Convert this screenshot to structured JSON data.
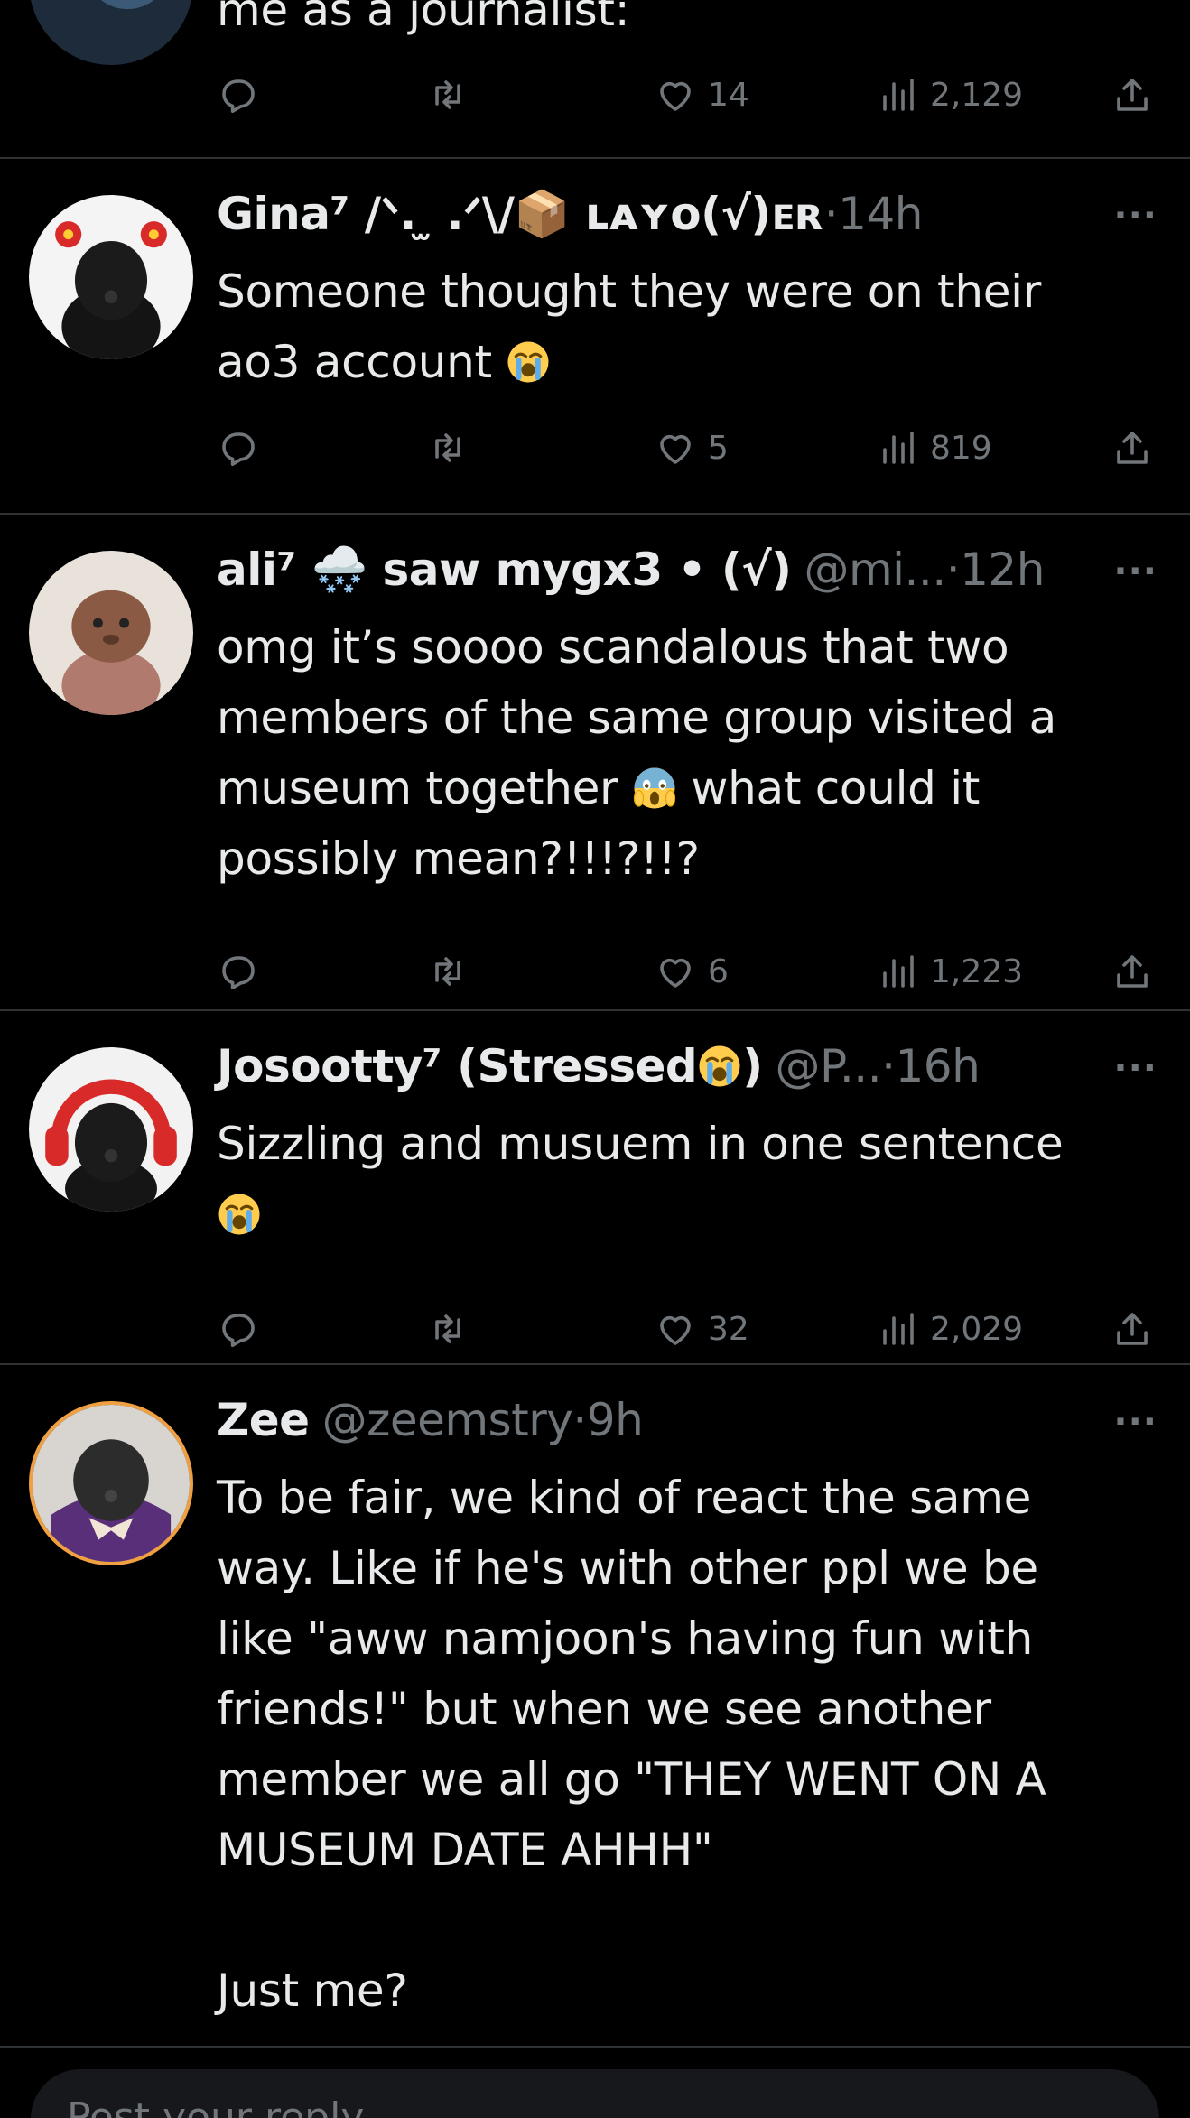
{
  "tweets": [
    {
      "name": "",
      "handle": "",
      "time": "",
      "text": "me as a journalist:",
      "stats": {
        "replies": "",
        "retweets": "",
        "likes": "14",
        "views": "2,129"
      }
    },
    {
      "name": "Gina⁷ /ᐠ. ̫ .ᐟ\\/📦 ʟᴀʏᴏ(√)ᴇʀ",
      "handle": "",
      "time": "14h",
      "text": "Someone thought they were on their\nao3 account ",
      "stats": {
        "replies": "",
        "retweets": "",
        "likes": "5",
        "views": "819"
      }
    },
    {
      "name": "ali⁷ 🌨️ saw mygx3 • (√)",
      "handle": "@mi...",
      "time": "12h",
      "text_a": "omg it’s soooo scandalous that two\nmembers of the same group visited a\nmuseum together ",
      "text_b": " what could it\npossibly mean?!!!?!!?",
      "stats": {
        "replies": "",
        "retweets": "",
        "likes": "6",
        "views": "1,223"
      }
    },
    {
      "name": "Josootty⁷ (Stressed",
      "name_end": ")",
      "handle": "@P...",
      "time": "16h",
      "text": "Sizzling and musuem in one sentence\n",
      "stats": {
        "replies": "",
        "retweets": "",
        "likes": "32",
        "views": "2,029"
      }
    },
    {
      "name": "Zee",
      "handle": "@zeemstry",
      "time": "9h",
      "text": "To be fair, we kind of react the same\nway. Like if he's with other ppl we be\nlike \"aww namjoon's having fun with\nfriends!\" but when we see another\nmember we all go \"THEY WENT ON A\nMUSEUM DATE AHHH\"\n\nJust me?"
    }
  ],
  "dot": "·",
  "more": "···",
  "compose": {
    "placeholder": "Post your reply"
  },
  "icons": {
    "reply": "reply-icon",
    "retweet": "retweet-icon",
    "like": "heart-icon",
    "views": "views-icon",
    "share": "share-icon",
    "cry": "loudly-crying-face-emoji",
    "scream": "screaming-face-emoji"
  },
  "colors": {
    "background": "#000000",
    "text": "#e7e9ea",
    "muted": "#71767b",
    "divider": "#2f3336"
  }
}
